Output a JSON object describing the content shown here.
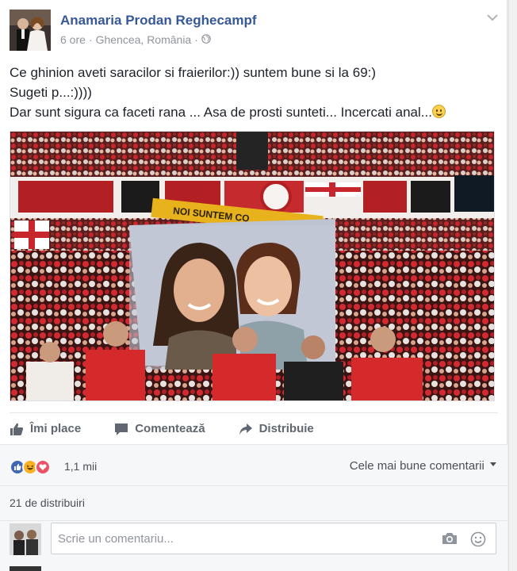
{
  "post": {
    "author": "Anamaria Prodan Reghecampf",
    "time": "6 ore",
    "separator": "·",
    "location": "Ghencea, România",
    "audience_icon": "globe-icon",
    "lines": [
      "Ce ghinion aveti saracilor si fraierilor:)) suntem bune si la 69:)",
      "Sugeti p...:))))",
      "Dar sunt sigura ca faceti rana ... Asa de prosti sunteti... Incercati anal..."
    ],
    "banner_text": "NOI SUNTEM CO"
  },
  "actions": {
    "like": "Îmi place",
    "comment": "Comentează",
    "share": "Distribuie"
  },
  "reactions": {
    "count": "1,1 mii",
    "types": [
      "like",
      "haha",
      "love"
    ],
    "sort_label": "Cele mai bune comentarii"
  },
  "shares": {
    "label": "21 de distribuiri"
  },
  "composer": {
    "placeholder": "Scrie un comentariu..."
  },
  "colors": {
    "link": "#365899",
    "like_blue": "#4267b2",
    "haha_yellow": "#f7b125",
    "love_red": "#ed5167",
    "crowd_red": "#c8262d"
  }
}
